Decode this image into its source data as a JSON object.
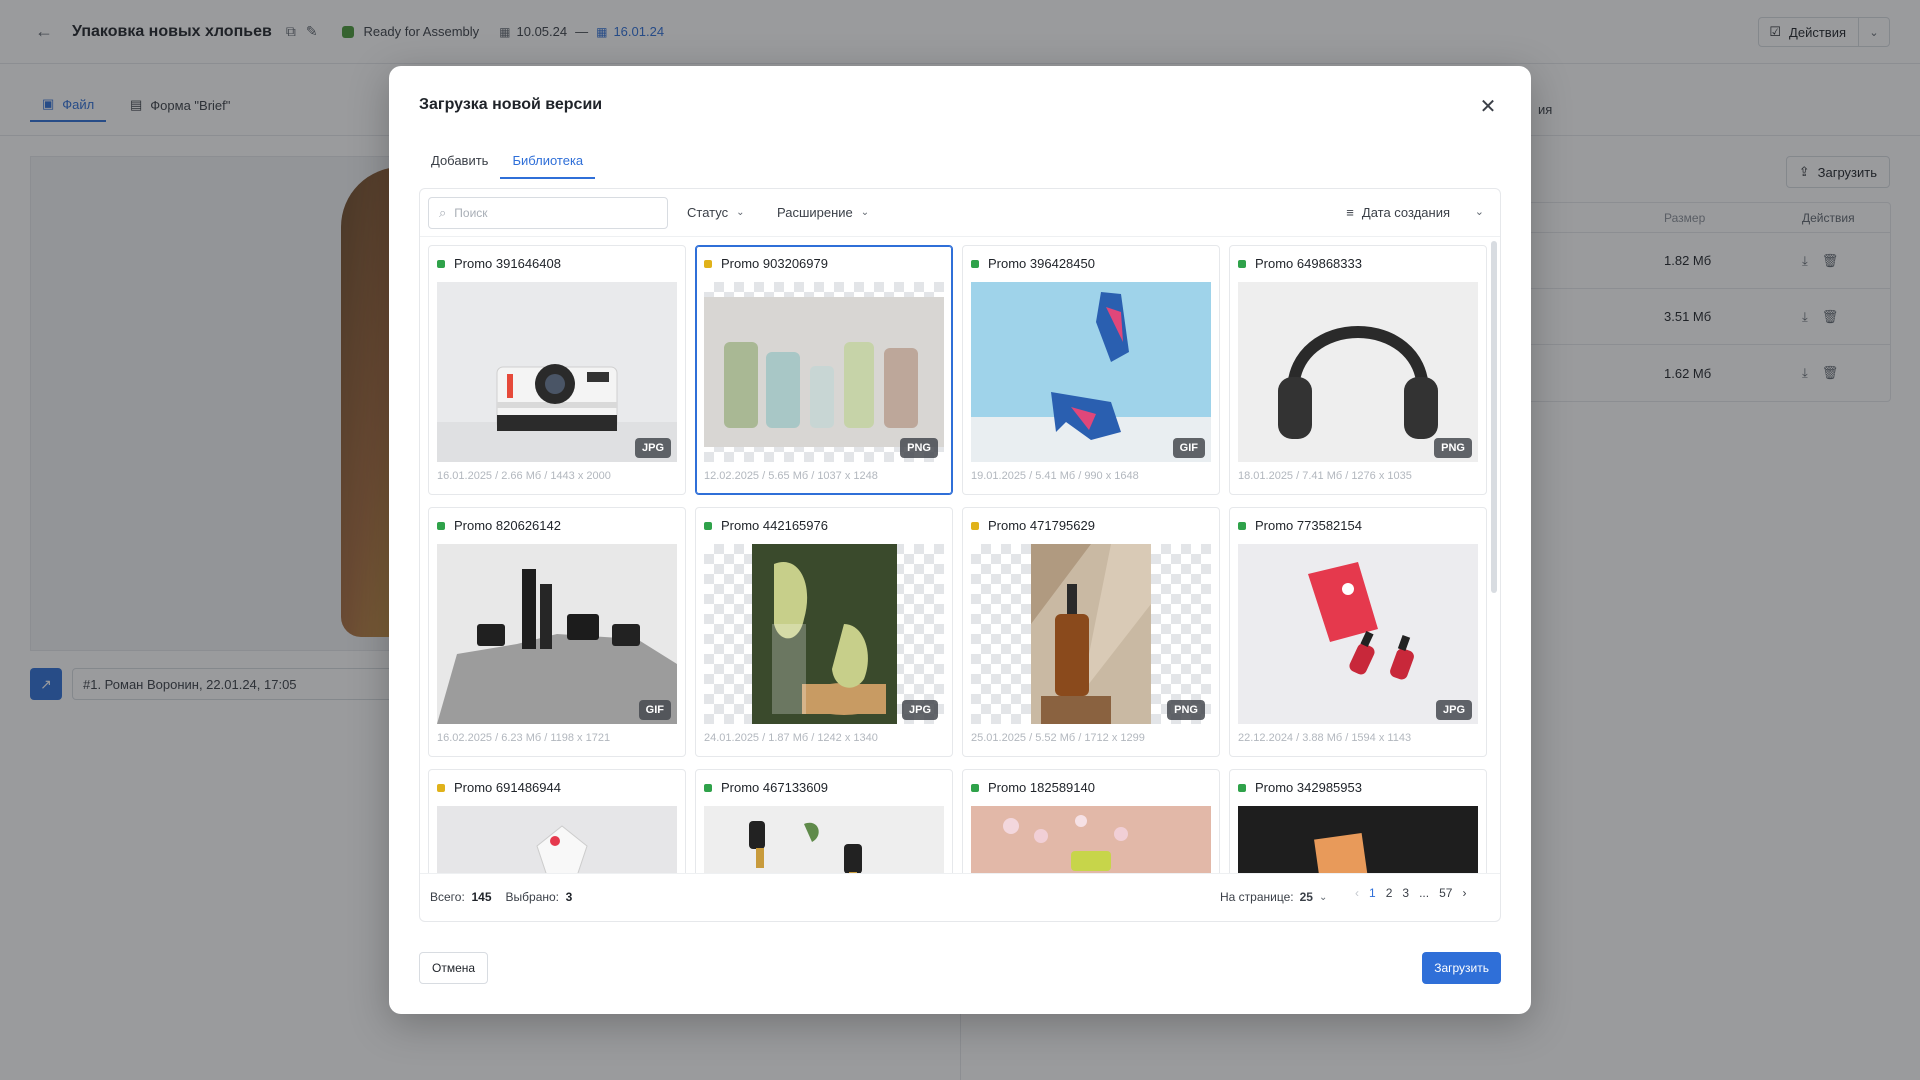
{
  "app": {
    "title": "Упаковка новых хлопьев",
    "status": "Ready for Assembly",
    "date_start": "10.05.24",
    "date_sep": "—",
    "date_end": "16.01.24",
    "actions_label": "Действия",
    "tabs": [
      {
        "label": "Файл",
        "active": true
      },
      {
        "label": "Форма \"Brief\"",
        "active": false
      }
    ],
    "right_tab_label": "ия",
    "comment": "#1. Роман Воронин, 22.01.24, 17:05",
    "upload_label": "Загрузить",
    "versions_table": {
      "headers": {
        "size": "Размер",
        "actions": "Действия"
      },
      "rows": [
        {
          "size": "1.82 Мб"
        },
        {
          "size": "3.51 Мб"
        },
        {
          "size": "1.62 Мб"
        }
      ]
    }
  },
  "modal": {
    "title": "Загрузка новой версии",
    "tabs": [
      {
        "label": "Добавить",
        "active": false
      },
      {
        "label": "Библиотека",
        "active": true
      }
    ],
    "search_placeholder": "Поиск",
    "filters": {
      "status": "Статус",
      "extension": "Расширение",
      "sort": "Дата создания"
    },
    "cards": [
      {
        "name": "Promo 391646408",
        "status": "green",
        "badge": "JPG",
        "meta": "16.01.2025  /  2.66 Мб  /  1443 x 2000",
        "selected": false
      },
      {
        "name": "Promo 903206979",
        "status": "yellow",
        "badge": "PNG",
        "meta": "12.02.2025  /  5.65 Мб  /  1037 x 1248",
        "selected": true
      },
      {
        "name": "Promo 396428450",
        "status": "green",
        "badge": "GIF",
        "meta": "19.01.2025  /  5.41 Мб  /  990 x 1648",
        "selected": false
      },
      {
        "name": "Promo 649868333",
        "status": "green",
        "badge": "PNG",
        "meta": "18.01.2025  /  7.41 Мб  /  1276 x 1035",
        "selected": false
      },
      {
        "name": "Promo 820626142",
        "status": "green",
        "badge": "GIF",
        "meta": "16.02.2025  /  6.23 Мб  /  1198 x 1721",
        "selected": false
      },
      {
        "name": "Promo 442165976",
        "status": "green",
        "badge": "JPG",
        "meta": "24.01.2025  /  1.87 Мб  /  1242 x 1340",
        "selected": false
      },
      {
        "name": "Promo 471795629",
        "status": "yellow",
        "badge": "PNG",
        "meta": "25.01.2025  /  5.52 Мб  /  1712 x 1299",
        "selected": false
      },
      {
        "name": "Promo 773582154",
        "status": "green",
        "badge": "JPG",
        "meta": "22.12.2024  /  3.88 Мб  /  1594 x 1143",
        "selected": false
      },
      {
        "name": "Promo 691486944",
        "status": "yellow",
        "badge": "",
        "meta": "",
        "selected": false
      },
      {
        "name": "Promo 467133609",
        "status": "green",
        "badge": "",
        "meta": "",
        "selected": false
      },
      {
        "name": "Promo 182589140",
        "status": "green",
        "badge": "",
        "meta": "",
        "selected": false
      },
      {
        "name": "Promo 342985953",
        "status": "green",
        "badge": "",
        "meta": "",
        "selected": false
      }
    ],
    "footer": {
      "total_label": "Всего:",
      "total": "145",
      "selected_label": "Выбрано:",
      "selected": "3",
      "per_page_label": "На странице:",
      "per_page": "25",
      "pages": [
        "1",
        "2",
        "3",
        "...",
        "57"
      ]
    },
    "cancel_label": "Отмена",
    "upload_label": "Загрузить",
    "colors": {
      "accent": "#2f6fd8",
      "status_green": "#2fa24a",
      "status_yellow": "#e0b21a"
    }
  }
}
